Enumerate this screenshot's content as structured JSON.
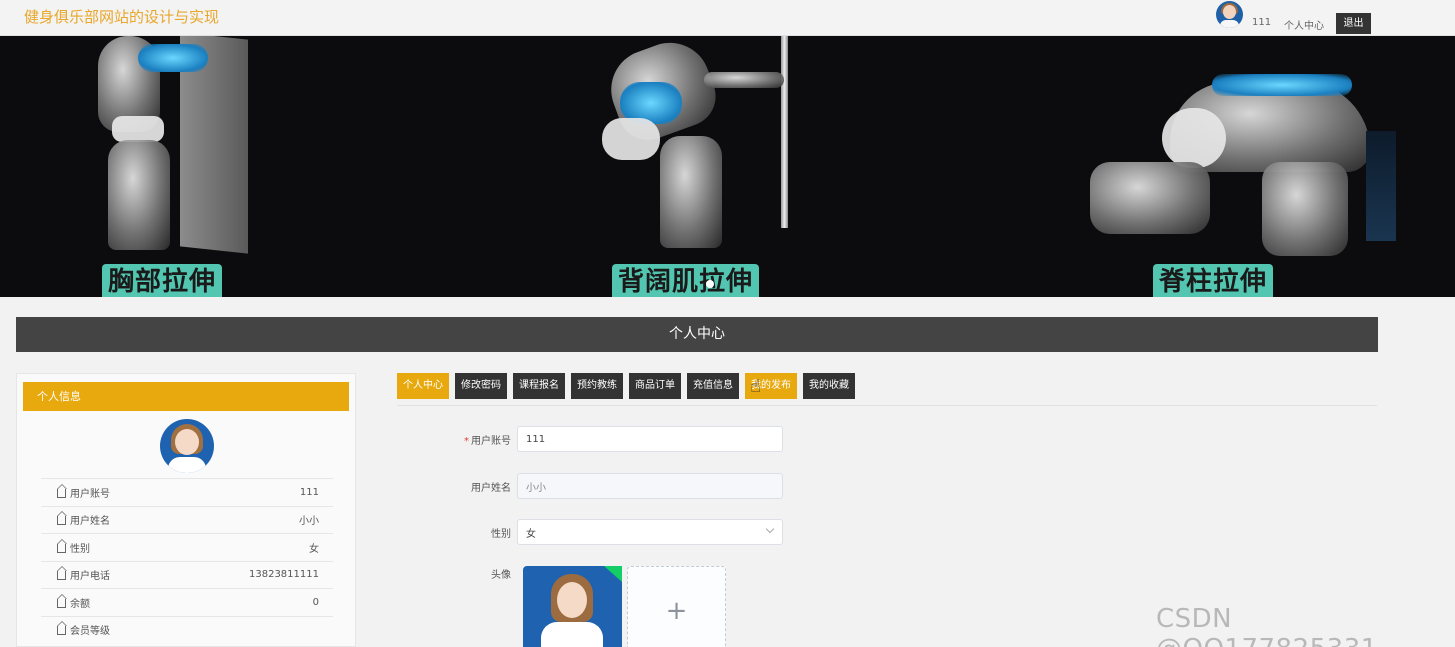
{
  "header": {
    "site_title": "健身俱乐部网站的设计与实现",
    "username": "111",
    "personal_center": "个人中心",
    "logout": "退出"
  },
  "banner": {
    "captions": [
      "胸部拉伸",
      "背阔肌拉伸",
      "脊柱拉伸"
    ]
  },
  "section": {
    "title": "个人中心"
  },
  "profile_card": {
    "title": "个人信息",
    "rows": [
      {
        "label": "用户账号",
        "value": "111"
      },
      {
        "label": "用户姓名",
        "value": "小小"
      },
      {
        "label": "性别",
        "value": "女"
      },
      {
        "label": "用户电话",
        "value": "13823811111"
      },
      {
        "label": "余额",
        "value": "0"
      },
      {
        "label": "会员等级",
        "value": ""
      }
    ]
  },
  "tabs": [
    {
      "label": "个人中心",
      "active": true
    },
    {
      "label": "修改密码",
      "active": false
    },
    {
      "label": "课程报名",
      "active": false
    },
    {
      "label": "预约教练",
      "active": false
    },
    {
      "label": "商品订单",
      "active": false
    },
    {
      "label": "充值信息",
      "active": false
    },
    {
      "label": "我的发布",
      "active": true
    },
    {
      "label": "我的收藏",
      "active": false
    }
  ],
  "form": {
    "account_label": "用户账号",
    "account_value": "111",
    "name_label": "用户姓名",
    "name_value": "小小",
    "gender_label": "性别",
    "gender_value": "女",
    "avatar_label": "头像",
    "upload_plus": "+"
  },
  "watermark": "CSDN @QQ177825331"
}
